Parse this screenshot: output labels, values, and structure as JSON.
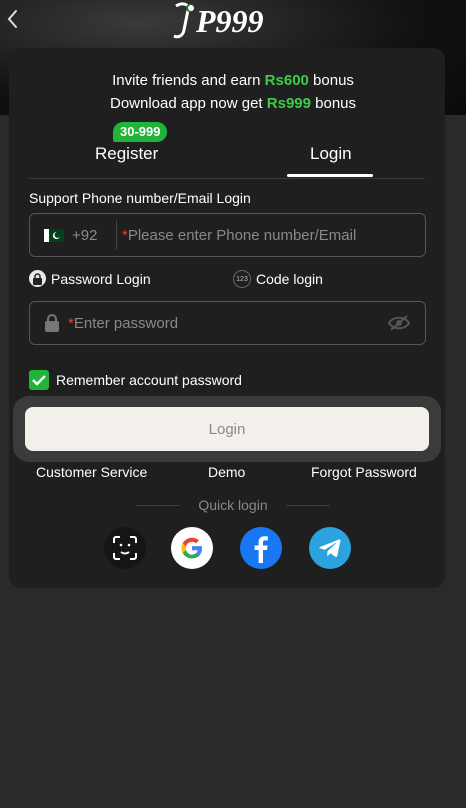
{
  "header": {
    "back_icon": "chevron-left-icon",
    "logo_text": "P999"
  },
  "invite": {
    "line1_prefix": "Invite friends and earn ",
    "line1_amount": "Rs600",
    "line1_suffix": " bonus",
    "line2_prefix": "Download app now get ",
    "line2_amount": "Rs999",
    "line2_suffix": " bonus",
    "amount_color": "#3dcc4a"
  },
  "tabs": {
    "register_label": "Register",
    "register_badge": "30-999",
    "login_label": "Login",
    "active": "Login"
  },
  "form": {
    "section_label": "Support Phone number/Email Login",
    "country_code": "+92",
    "phone_required_mark": "*",
    "phone_placeholder": "Please enter Phone number/Email",
    "password_login_label": "Password Login",
    "code_login_label": "Code login",
    "code_icon_text": "123",
    "password_required_mark": "*",
    "password_placeholder": "Enter password",
    "remember_label": "Remember account password",
    "remember_checked": true,
    "login_button": "Login"
  },
  "links": {
    "customer_service": "Customer Service",
    "demo": "Demo",
    "forgot_password": "Forgot Password"
  },
  "quick_login": {
    "label": "Quick login",
    "providers": [
      "face-id-icon",
      "google-icon",
      "facebook-icon",
      "telegram-icon"
    ]
  },
  "colors": {
    "accent_green": "#22b33a",
    "background": "#2a2a2a",
    "card": "#1f1f1f",
    "facebook": "#1877f2",
    "telegram": "#2aa3df"
  }
}
